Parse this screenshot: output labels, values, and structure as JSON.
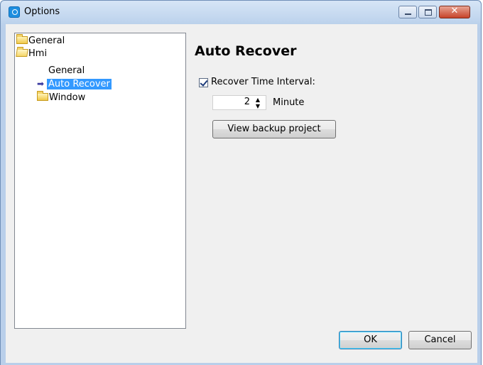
{
  "window": {
    "title": "Options"
  },
  "tree": {
    "items": [
      {
        "label": "General",
        "icon": "folder-closed-icon"
      },
      {
        "label": "Hmi",
        "icon": "folder-open-icon"
      },
      {
        "label": "General"
      },
      {
        "label": "Auto Recover",
        "selected": true,
        "icon": "arrow-right-icon"
      },
      {
        "label": "Window",
        "icon": "folder-closed-icon"
      }
    ]
  },
  "content": {
    "title": "Auto Recover",
    "recover_checkbox": {
      "label": "Recover Time Interval:",
      "checked": true
    },
    "interval": {
      "value": "2",
      "unit_label": "Minute"
    },
    "view_backup_label": "View backup project"
  },
  "footer": {
    "ok_label": "OK",
    "cancel_label": "Cancel"
  },
  "colors": {
    "selection": "#3399ff",
    "dialog_bg": "#f0f0f0",
    "titlebar": "#bcd2ec"
  }
}
